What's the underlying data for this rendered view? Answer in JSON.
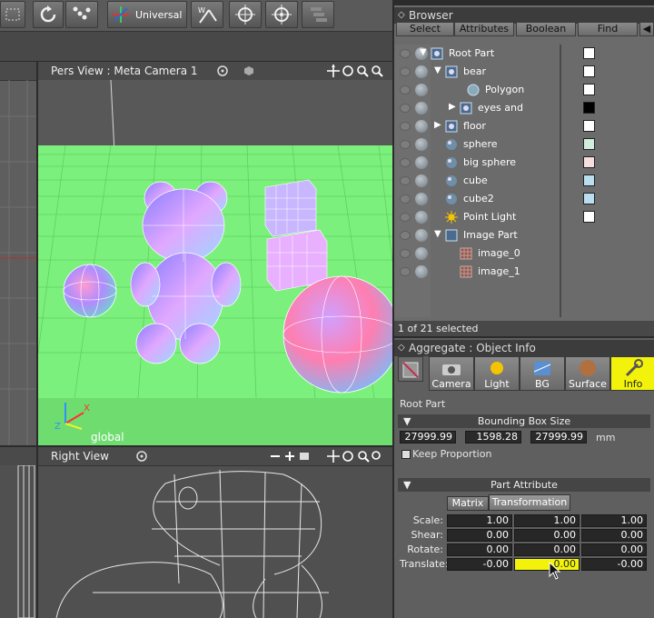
{
  "toolbar": {
    "mode_label": "Universal"
  },
  "pers_view": {
    "title": "Pers View : Meta Camera 1",
    "axis_label": "global"
  },
  "right_view": {
    "title": "Right View"
  },
  "browser": {
    "title": "Browser",
    "menu": [
      "Select",
      "Attributes",
      "Boolean",
      "Find"
    ],
    "tree": [
      {
        "label": "Root Part",
        "swatch": "#ffffff"
      },
      {
        "label": "bear",
        "swatch": "#ffffff"
      },
      {
        "label": "Polygon",
        "swatch": "#ffffff"
      },
      {
        "label": "eyes and",
        "swatch": "#000000"
      },
      {
        "label": "floor",
        "swatch": "#ffffff"
      },
      {
        "label": "sphere",
        "swatch": "#cfeedd"
      },
      {
        "label": "big sphere",
        "swatch": "#f6dede"
      },
      {
        "label": "cube",
        "swatch": "#b9def0"
      },
      {
        "label": "cube2",
        "swatch": "#b9def0"
      },
      {
        "label": "Point Light",
        "swatch": "#ffffff"
      },
      {
        "label": "Image Part",
        "swatch": ""
      },
      {
        "label": "image_0",
        "swatch": ""
      },
      {
        "label": "image_1",
        "swatch": ""
      }
    ],
    "status": "1 of 21 selected"
  },
  "object_info": {
    "title": "Aggregate : Object Info",
    "tabs": [
      "Camera",
      "Light",
      "BG",
      "Surface",
      "Info"
    ],
    "part_name": "Root Part",
    "bounding_box": {
      "label": "Bounding Box Size",
      "x": "27999.99",
      "y": "1598.28",
      "z": "27999.99",
      "unit": "mm"
    },
    "keep_proportion": "Keep Proportion",
    "part_attribute": "Part Attribute",
    "subtabs": [
      "Matrix",
      "Transformation"
    ],
    "rows": [
      {
        "label": "Scale:",
        "values": [
          "1.00",
          "1.00",
          "1.00"
        ]
      },
      {
        "label": "Shear:",
        "values": [
          "0.00",
          "0.00",
          "0.00"
        ]
      },
      {
        "label": "Rotate:",
        "values": [
          "0.00",
          "0.00",
          "0.00"
        ]
      },
      {
        "label": "Translate:",
        "values": [
          "-0.00",
          "0.00",
          "-0.00"
        ]
      }
    ]
  }
}
